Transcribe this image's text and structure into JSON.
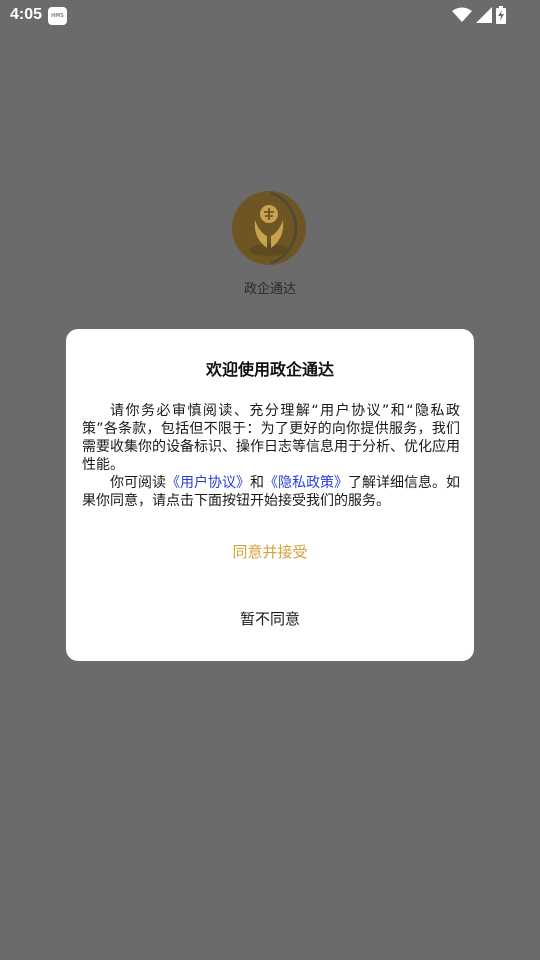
{
  "status_bar": {
    "time": "4:05",
    "app_icon_text": "HMS",
    "icons": [
      "wifi-icon",
      "signal-icon",
      "battery-icon"
    ]
  },
  "splash": {
    "logo_icon": "app-logo-icon",
    "app_name": "政企通达"
  },
  "dialog": {
    "title": "欢迎使用政企通达",
    "paragraph1": "请你务必审慎阅读、充分理解“用户协议”和“隐私政策”各条款，包括但不限于：为了更好的向你提供服务，我们需要收集你的设备标识、操作日志等信息用于分析、优化应用性能。",
    "paragraph2_prefix": "你可阅读",
    "user_agreement_link": "《用户协议》",
    "paragraph2_and": "和",
    "privacy_policy_link": "《隐私政策》",
    "paragraph2_suffix": "了解详细信息。如果你同意，请点击下面按钮开始接受我们的服务。",
    "accept_label": "同意并接受",
    "decline_label": "暂不同意"
  },
  "colors": {
    "overlay": "#6b6b6b",
    "accent": "#d4a23a",
    "link": "#2a3fd6",
    "logo_gold": "#8a6a2c"
  }
}
